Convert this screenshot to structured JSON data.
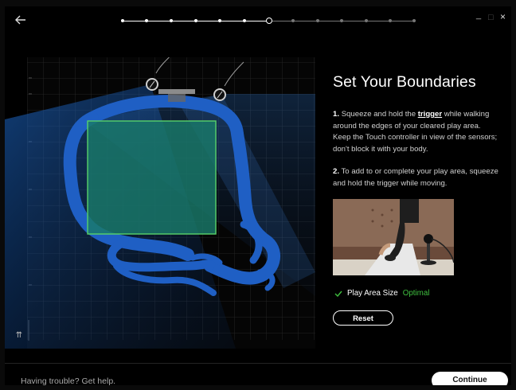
{
  "window": {
    "minimize_symbol": "_",
    "maximize_symbol": "□",
    "close_symbol": "×"
  },
  "progress": {
    "total_steps": 13,
    "current_step": 7
  },
  "map": {
    "height_label": "⇈"
  },
  "setup": {
    "title": "Set Your Boundaries",
    "step1_number": "1.",
    "step1_pre": "Squeeze and hold the",
    "step1_link": "trigger",
    "step1_post": "while walking around the edges of your cleared play area. Keep the Touch controller in view of the sensors; don't block it with your body.",
    "step2_number": "2.",
    "step2_text": "To add to or complete your play area, squeeze and hold the trigger while moving.",
    "status_icon": "check-icon",
    "status_label": "Play Area Size",
    "status_value": "Optimal",
    "reset_label": "Reset"
  },
  "footer": {
    "help_text": "Having trouble? Get help.",
    "continue_label": "Continue"
  },
  "colors": {
    "accent_green": "#3fbf3f",
    "boundary_blue": "#1f5fc4",
    "play_area_fill": "#1a7a6a"
  }
}
